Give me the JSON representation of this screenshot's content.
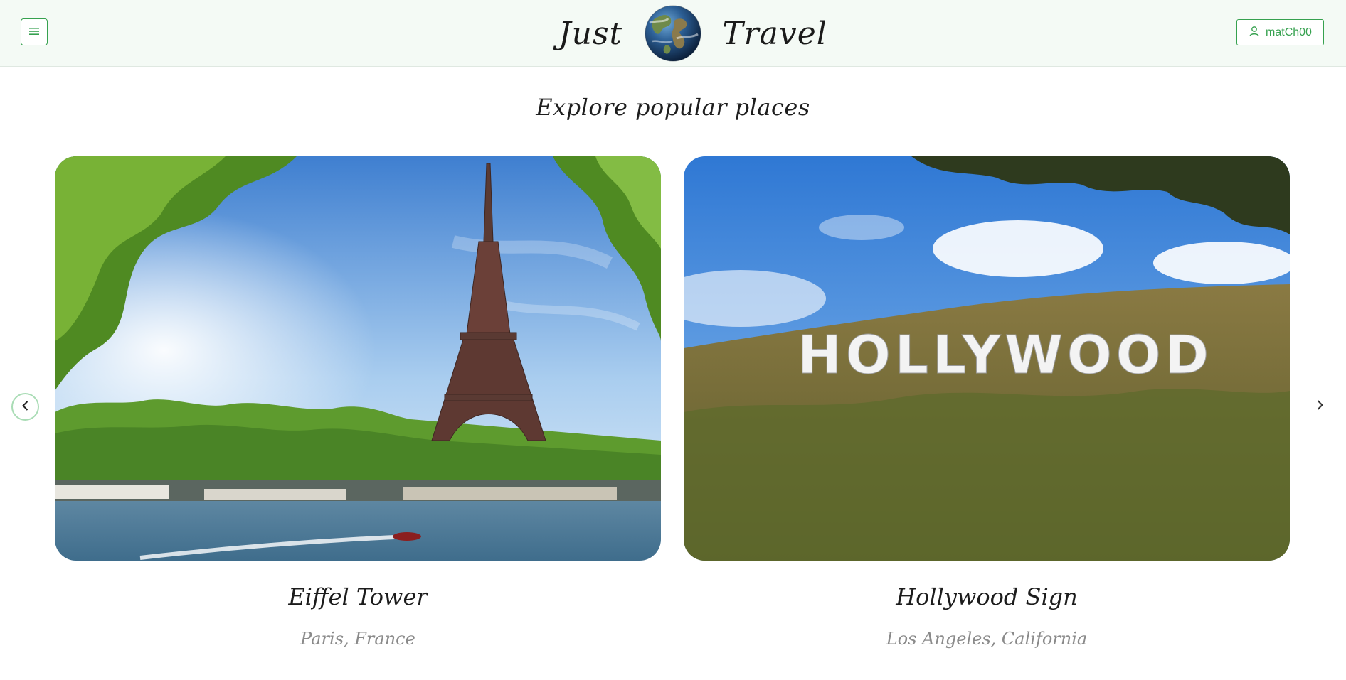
{
  "header": {
    "brand_left": "Just",
    "brand_right": "Travel",
    "logo_icon": "globe-icon",
    "menu_icon": "hamburger-menu-icon",
    "user_icon": "user-icon",
    "username": "matCh00",
    "accent_color": "#36a14f"
  },
  "main": {
    "section_title": "Explore popular places",
    "carousel": {
      "prev_icon": "chevron-left-icon",
      "next_icon": "chevron-right-icon",
      "cards": [
        {
          "title": "Eiffel Tower",
          "subtitle": "Paris, France",
          "image": "eiffel-tower-photo"
        },
        {
          "title": "Hollywood Sign",
          "subtitle": "Los Angeles, California",
          "image": "hollywood-sign-photo",
          "sign_text": "HOLLYWOOD"
        }
      ]
    }
  }
}
